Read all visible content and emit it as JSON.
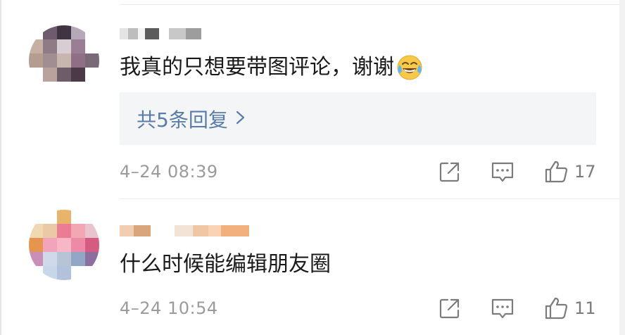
{
  "comments": [
    {
      "author": "",
      "text": "我真的只想要带图评论，谢谢",
      "emoji": "laughing-tears-emoji",
      "replies_label": "共5条回复",
      "timestamp": "4–24 08:39",
      "likes": "17",
      "avatar_colors": [
        "#ffffff",
        "#6e5b6e",
        "#3f3542",
        "#b6a8b8",
        "#ffffff",
        "#c6b0a4",
        "#8f7b86",
        "#d8cdd2",
        "#9a7f94",
        "#ffffff",
        "#b49c8e",
        "#a08e92",
        "#c7b6b0",
        "#8e6f86",
        "#7a6a78",
        "#ffffff",
        "#b8a29b",
        "#6e5c69",
        "#4a3a48",
        "#ffffff",
        "#ffffff",
        "#ffffff",
        "#ffffff",
        "#ffffff",
        "#ffffff"
      ],
      "author_colors": [
        "#e4e4e4",
        "#bdbdbd",
        "#f4f4f4",
        "#5c5c5c",
        "#ffffff",
        "#c8c8c8",
        "#9d9d9d"
      ]
    },
    {
      "author": "",
      "text": "什么时候能编辑朋友圈",
      "replies_label": "",
      "timestamp": "4–24 10:54",
      "likes": "11",
      "avatar_colors": [
        "#ffffff",
        "#ffffff",
        "#e7b46a",
        "#ffffff",
        "#ffffff",
        "#f0d9b2",
        "#ecc9a6",
        "#ec7c93",
        "#f3a7b4",
        "#e9c4ce",
        "#e5954f",
        "#f3a4bd",
        "#f7b7c6",
        "#ec8aa7",
        "#d65b82",
        "#c98fb6",
        "#cfd9ea",
        "#b7c4d6",
        "#93a6c5",
        "#8c6f9e",
        "#ffffff",
        "#c8d6ea",
        "#b3c2dc",
        "#ffffff",
        "#ffffff"
      ],
      "author_colors": [
        "#f3cdb2",
        "#d9a57c",
        "#ffffff",
        "#f3e2d6",
        "#f0c7a5",
        "#fad3b4",
        "#f2b07e"
      ]
    }
  ],
  "colors": {
    "link": "#5a7ca8",
    "meta": "#9b9b9b",
    "icon": "#7b7b7b",
    "reply_bg": "#f4f5f7"
  },
  "icons": {
    "share": "share-icon",
    "comment": "comment-icon",
    "like": "like-icon",
    "chevron": "chevron-right-icon"
  }
}
